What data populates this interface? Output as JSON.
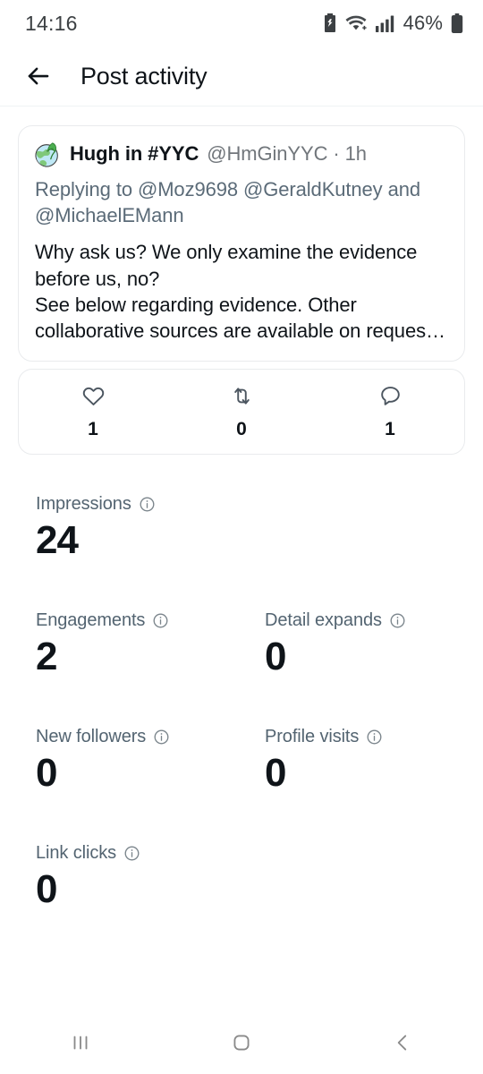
{
  "status_bar": {
    "time": "14:16",
    "battery_percent": "46%",
    "icons": [
      "alarm-battery-icon",
      "wifi-icon",
      "cellular-signal-icon",
      "battery-icon"
    ]
  },
  "header": {
    "back_label": "back-arrow",
    "title": "Post activity"
  },
  "tweet": {
    "avatar": "globe-leaf-avatar",
    "author_name": "Hugh in #YYC",
    "handle_and_time": "@HmGinYYC · 1h",
    "replying_to": "Replying to @Moz9698 @GeraldKutney and @MichaelEMann",
    "body": "Why ask us? We only examine the evidence before us, no?\nSee below regarding evidence. Other collaborative sources are available on reques…"
  },
  "engagement": [
    {
      "icon": "heart-icon",
      "name": "likes",
      "count": "1"
    },
    {
      "icon": "retweet-icon",
      "name": "reposts",
      "count": "0"
    },
    {
      "icon": "reply-icon",
      "name": "replies",
      "count": "1"
    }
  ],
  "metrics": [
    {
      "label": "Impressions",
      "value": "24"
    },
    {
      "label": "Engagements",
      "value": "2"
    },
    {
      "label": "Detail expands",
      "value": "0"
    },
    {
      "label": "New followers",
      "value": "0"
    },
    {
      "label": "Profile visits",
      "value": "0"
    },
    {
      "label": "Link clicks",
      "value": "0"
    }
  ],
  "nav_bar": {
    "recents": "recents-icon",
    "home": "home-icon",
    "back": "back-icon"
  },
  "colors": {
    "text_primary": "#0f1419",
    "text_secondary": "#536471",
    "handle_gray": "#71767b",
    "card_border": "#e9ebed",
    "divider": "#eff3f4",
    "nav_icon": "#8a8a8a"
  }
}
